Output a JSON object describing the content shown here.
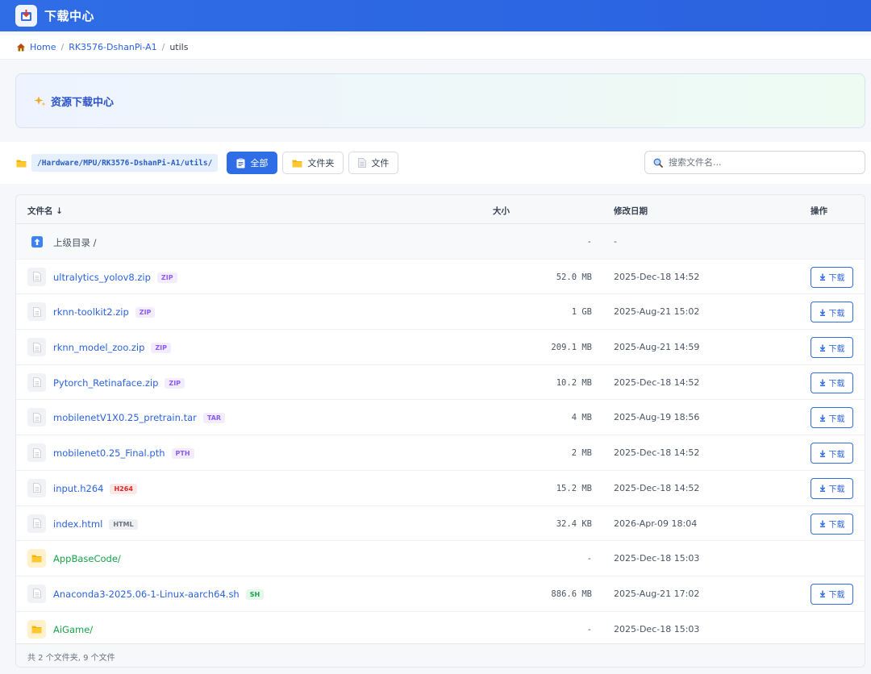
{
  "header": {
    "title": "下载中心"
  },
  "breadcrumb": {
    "home": "Home",
    "parent": "RK3576-DshanPi-A1",
    "current": "utils",
    "sep": "/"
  },
  "banner": {
    "title": "资源下载中心"
  },
  "toolbar": {
    "path": "/Hardware/MPU/RK3576-DshanPi-A1/utils/",
    "filters": {
      "all": "全部",
      "folders": "文件夹",
      "files": "文件"
    },
    "search_placeholder": "搜索文件名..."
  },
  "table": {
    "headers": {
      "name": "文件名 ↓",
      "size": "大小",
      "date": "修改日期",
      "action": "操作"
    },
    "parent": {
      "name": "上级目录 /",
      "size": "-",
      "date": "-"
    },
    "rows": [
      {
        "name": "ultralytics_yolov8.zip",
        "badge": "ZIP",
        "size": "52.0 MB",
        "date": "2025-Dec-18 14:52",
        "action": "下载"
      },
      {
        "name": "rknn-toolkit2.zip",
        "badge": "ZIP",
        "size": "1 GB",
        "date": "2025-Aug-21 15:02",
        "action": "下载"
      },
      {
        "name": "rknn_model_zoo.zip",
        "badge": "ZIP",
        "size": "209.1 MB",
        "date": "2025-Aug-21 14:59",
        "action": "下载"
      },
      {
        "name": "Pytorch_Retinaface.zip",
        "badge": "ZIP",
        "size": "10.2 MB",
        "date": "2025-Dec-18 14:52",
        "action": "下载"
      },
      {
        "name": "mobilenetV1X0.25_pretrain.tar",
        "badge": "TAR",
        "size": "4 MB",
        "date": "2025-Aug-19 18:56",
        "action": "下载"
      },
      {
        "name": "mobilenet0.25_Final.pth",
        "badge": "PTH",
        "size": "2 MB",
        "date": "2025-Dec-18 14:52",
        "action": "下载"
      },
      {
        "name": "input.h264",
        "badge": "H264",
        "size": "15.2 MB",
        "date": "2025-Dec-18 14:52",
        "action": "下载"
      },
      {
        "name": "index.html",
        "badge": "HTML",
        "size": "32.4 KB",
        "date": "2026-Apr-09 18:04",
        "action": "下载"
      },
      {
        "name": "AppBaseCode/",
        "size": "-",
        "date": "2025-Dec-18 15:03"
      },
      {
        "name": "Anaconda3-2025.06-1-Linux-aarch64.sh",
        "badge": "SH",
        "size": "886.6 MB",
        "date": "2025-Aug-21 17:02",
        "action": "下载"
      },
      {
        "name": "AiGame/",
        "size": "-",
        "date": "2025-Dec-18 15:03"
      }
    ],
    "footer": "共 2 个文件夹, 9 个文件"
  }
}
